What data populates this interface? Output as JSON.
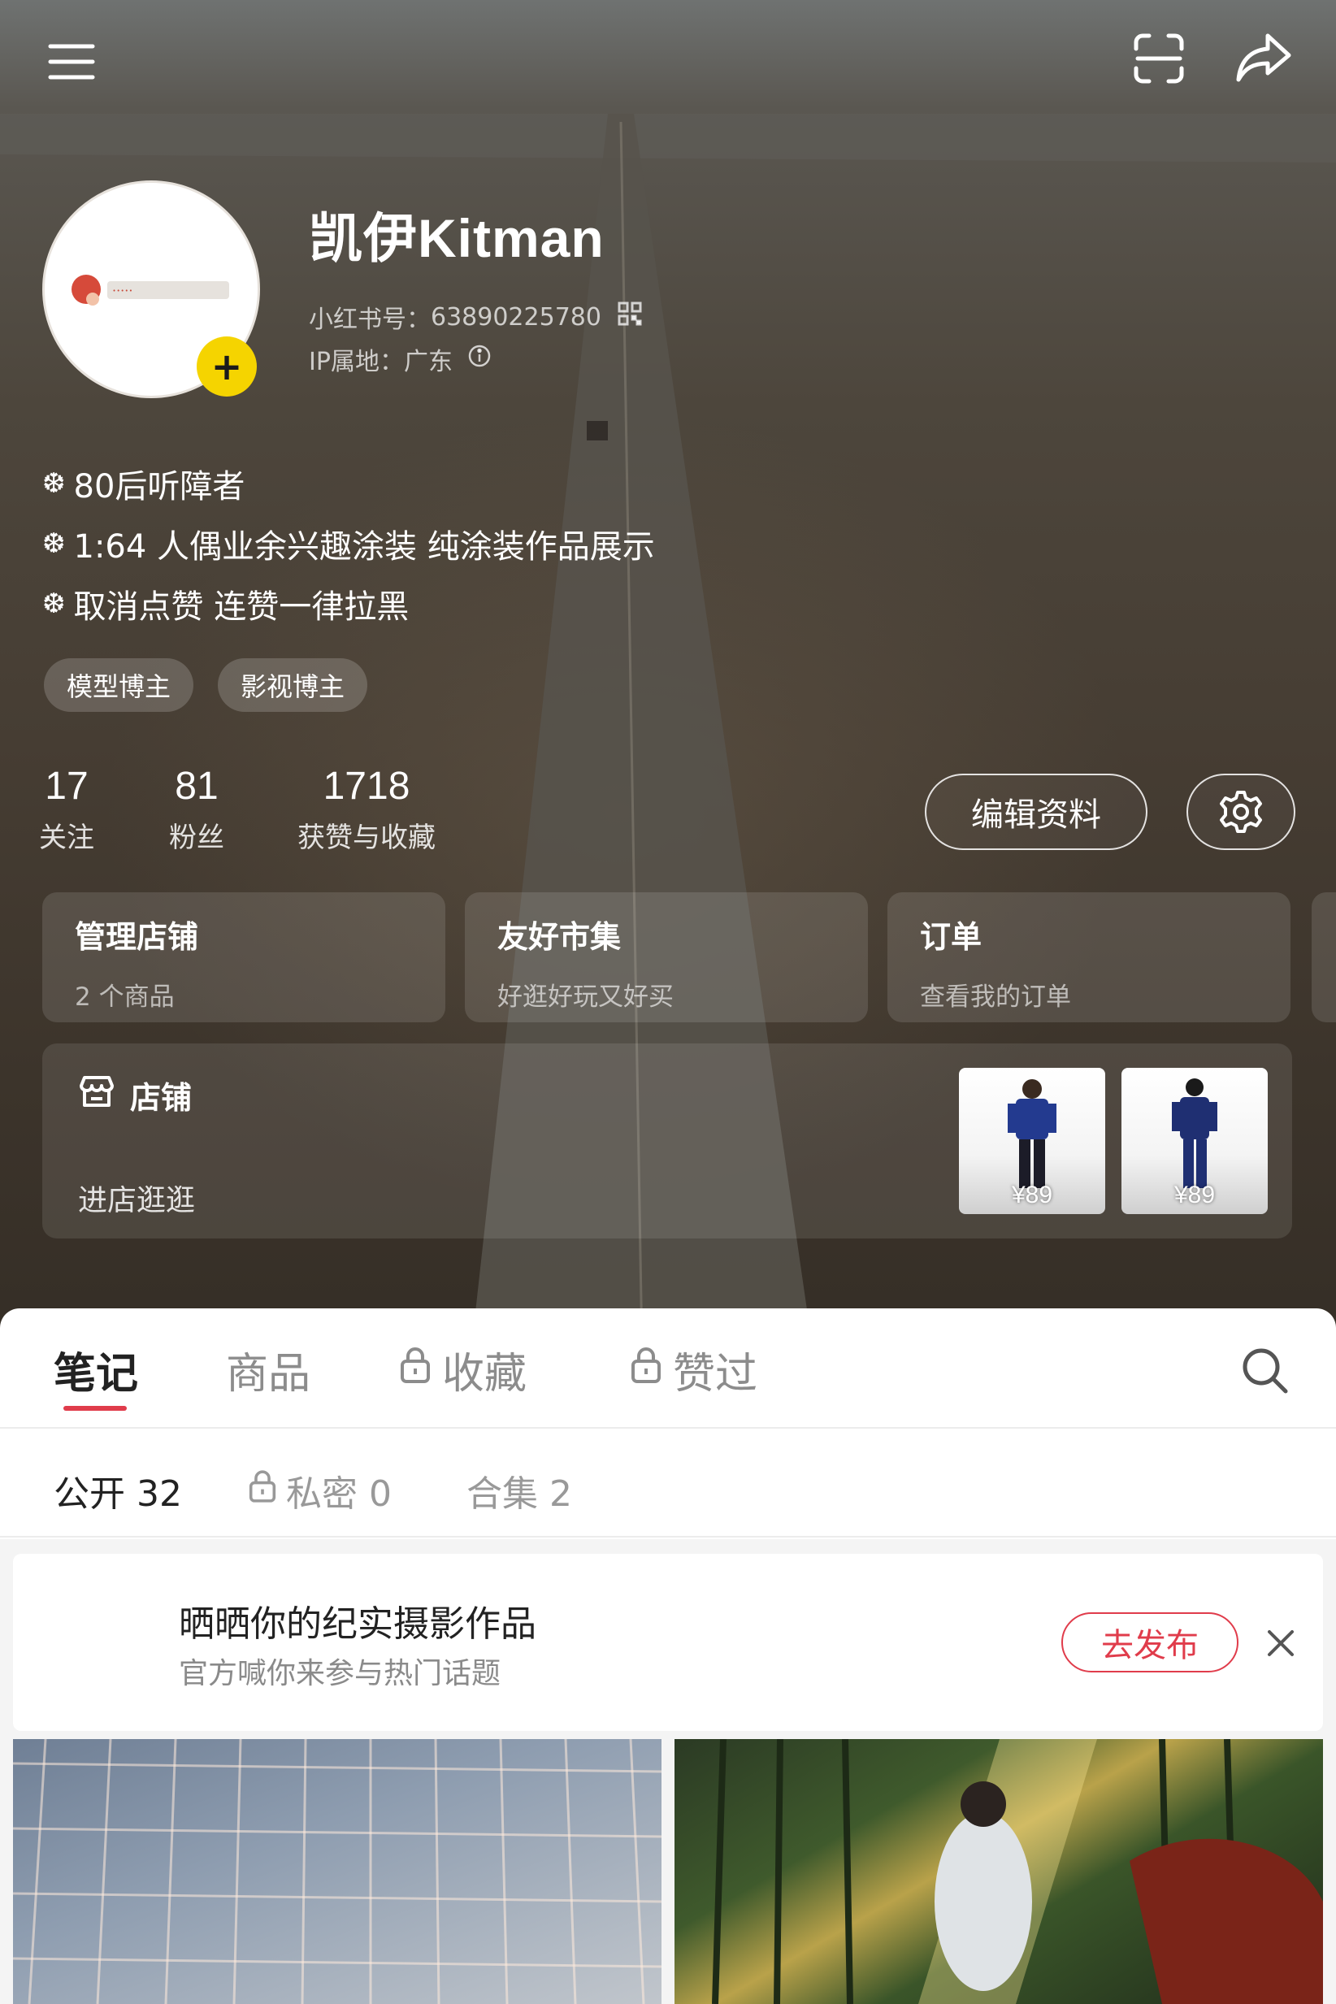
{
  "profile": {
    "username": "凯伊Kitman",
    "id_label": "小红书号：",
    "id_value": "63890225780",
    "ip_label": "IP属地：",
    "ip_value": "广东",
    "bio": [
      "80后听障者",
      "1:64 人偶业余兴趣涂装 纯涂装作品展示",
      "取消点赞 连赞一律拉黑"
    ],
    "tags": [
      "模型博主",
      "影视博主"
    ],
    "avatar_badge": "+"
  },
  "stats": [
    {
      "num": "17",
      "label": "关注"
    },
    {
      "num": "81",
      "label": "粉丝"
    },
    {
      "num": "1718",
      "label": "获赞与收藏"
    }
  ],
  "actions": {
    "edit_profile": "编辑资料"
  },
  "cards": [
    {
      "title": "管理店铺",
      "subtitle": "2 个商品"
    },
    {
      "title": "友好市集",
      "subtitle": "好逛好玩又好买"
    },
    {
      "title": "订单",
      "subtitle": "查看我的订单"
    }
  ],
  "shop": {
    "title": "店铺",
    "subtitle": "进店逛逛",
    "products": [
      {
        "price": "¥89"
      },
      {
        "price": "¥89"
      }
    ]
  },
  "tabs": [
    "笔记",
    "商品",
    "收藏",
    "赞过"
  ],
  "subtabs": [
    "公开 32",
    "私密 0",
    "合集 2"
  ],
  "promo": {
    "title": "晒晒你的纪实摄影作品",
    "subtitle": "官方喊你来参与热门话题",
    "button": "去发布"
  },
  "colors": {
    "accent": "#e03c4b",
    "badge_yellow": "#f5d400"
  },
  "icons": [
    "menu-icon",
    "scan-icon",
    "share-icon",
    "qr-code-icon",
    "info-icon",
    "gear-icon",
    "store-icon",
    "lock-icon",
    "search-icon",
    "close-icon"
  ]
}
